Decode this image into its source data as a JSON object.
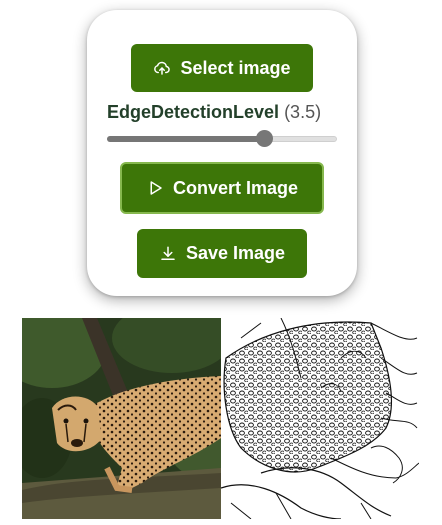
{
  "controls": {
    "select_label": "Select image",
    "level_name": "EdgeDetectionLevel",
    "level_display": "(3.5)",
    "level_value": 3.5,
    "convert_label": "Convert Image",
    "save_label": "Save Image"
  },
  "colors": {
    "button_bg": "#3d7608",
    "button_text": "#ffffff",
    "label_text": "#23402a",
    "slider_fill": "#767676"
  },
  "icons": {
    "select": "cloud-upload-icon",
    "convert": "play-icon",
    "save": "download-icon"
  }
}
